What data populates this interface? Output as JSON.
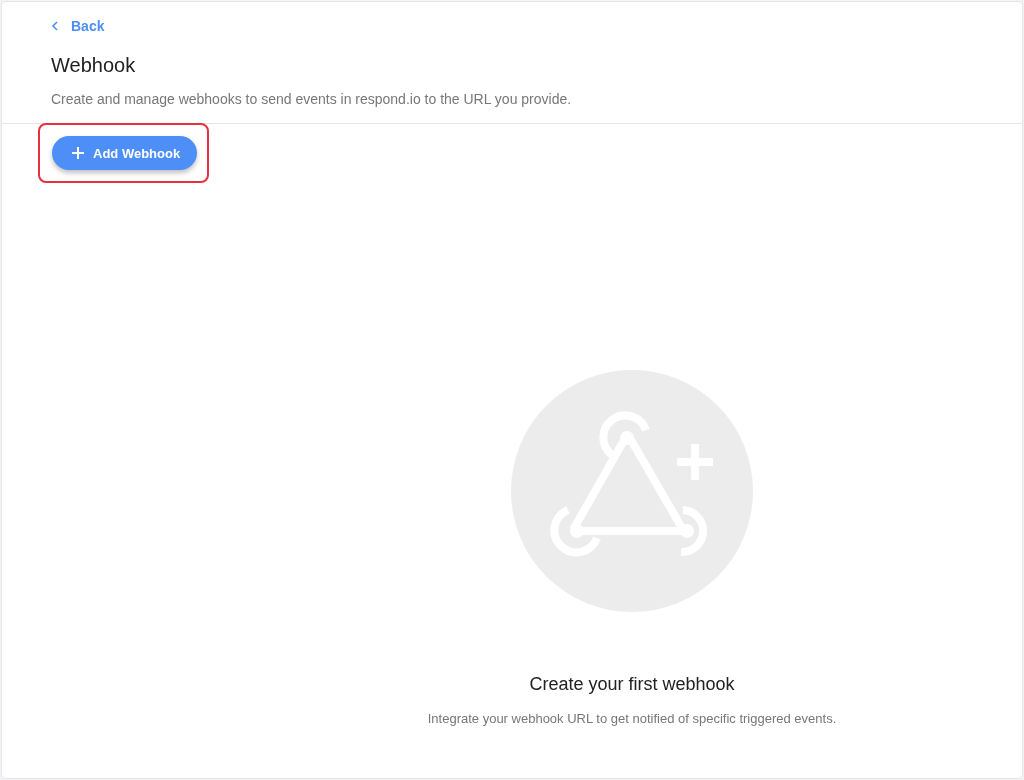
{
  "back_link": {
    "label": "Back"
  },
  "header": {
    "title": "Webhook",
    "description": "Create and manage webhooks to send events in respond.io to the URL you provide."
  },
  "add_button": {
    "label": "Add Webhook",
    "highlighted": true
  },
  "empty_state": {
    "title": "Create your first webhook",
    "message": "Integrate your webhook URL to get notified of specific triggered events."
  }
}
